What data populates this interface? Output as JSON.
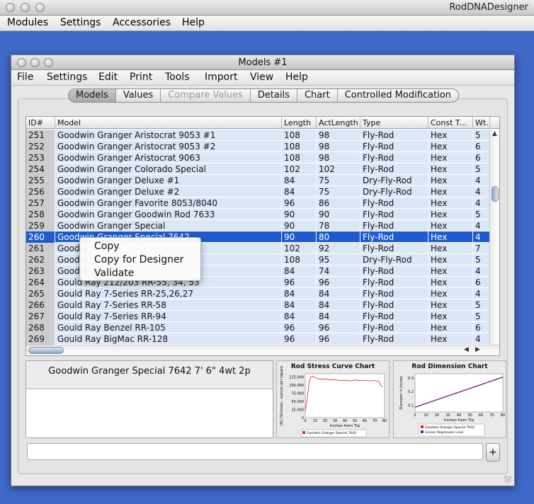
{
  "app": {
    "title": "RodDNADesigner",
    "menus": [
      "Modules",
      "Settings",
      "Accessories",
      "Help"
    ]
  },
  "window": {
    "title": "Models #1",
    "menus": [
      "File",
      "Settings",
      "Edit",
      "Print",
      "Tools",
      "Import",
      "View",
      "Help"
    ]
  },
  "tabs": [
    {
      "label": "Models",
      "state": "active"
    },
    {
      "label": "Values",
      "state": "normal"
    },
    {
      "label": "Compare Values",
      "state": "disabled"
    },
    {
      "label": "Details",
      "state": "normal"
    },
    {
      "label": "Chart",
      "state": "normal"
    },
    {
      "label": "Controlled Modification",
      "state": "normal"
    }
  ],
  "table": {
    "columns": [
      "ID#",
      "Model",
      "Length",
      "ActLength",
      "Type",
      "Const T...",
      "Wt."
    ],
    "rows": [
      [
        "251",
        "Goodwin Granger Aristocrat 9053 #1",
        "108",
        "98",
        "Fly-Rod",
        "Hex",
        "5"
      ],
      [
        "252",
        "Goodwin Granger Aristocrat 9053 #2",
        "108",
        "98",
        "Fly-Rod",
        "Hex",
        "6"
      ],
      [
        "253",
        "Goodwin Granger Aristocrat 9063",
        "108",
        "98",
        "Fly-Rod",
        "Hex",
        "6"
      ],
      [
        "254",
        "Goodwin Granger Colorado Special",
        "102",
        "102",
        "Fly-Rod",
        "Hex",
        "5"
      ],
      [
        "255",
        "Goodwin Granger Deluxe #1",
        "84",
        "75",
        "Dry-Fly-Rod",
        "Hex",
        "4"
      ],
      [
        "256",
        "Goodwin Granger Deluxe #2",
        "84",
        "75",
        "Dry-Fly-Rod",
        "Hex",
        "4"
      ],
      [
        "257",
        "Goodwin Granger Favorite 8053/8040",
        "96",
        "86",
        "Fly-Rod",
        "Hex",
        "4"
      ],
      [
        "258",
        "Goodwin Granger Goodwin Rod 7633",
        "90",
        "90",
        "Fly-Rod",
        "Hex",
        "5"
      ],
      [
        "259",
        "Goodwin Granger Special",
        "90",
        "78",
        "Fly-Rod",
        "Hex",
        "4"
      ],
      [
        "260",
        "Goodwin Granger Special 7642",
        "90",
        "80",
        "Fly-Rod",
        "Hex",
        "4"
      ],
      [
        "261",
        "Goodw",
        "102",
        "92",
        "Fly-Rod",
        "Hex",
        "7"
      ],
      [
        "262",
        "Goodw",
        "108",
        "95",
        "Dry-Fly-Rod",
        "Hex",
        "5"
      ],
      [
        "263",
        "Goodw",
        "84",
        "74",
        "Fly-Rod",
        "Hex",
        "4"
      ],
      [
        "264",
        "Gould Ray 212/203 RR-55, 34, 53",
        "96",
        "96",
        "Fly-Rod",
        "Hex",
        "6"
      ],
      [
        "265",
        "Gould Ray 7-Series RR-25,26,27",
        "84",
        "84",
        "Fly-Rod",
        "Hex",
        "4"
      ],
      [
        "266",
        "Gould Ray 7-Series RR-58",
        "84",
        "84",
        "Fly-Rod",
        "Hex",
        "5"
      ],
      [
        "267",
        "Gould Ray 7-Series RR-94",
        "84",
        "84",
        "Fly-Rod",
        "Hex",
        "5"
      ],
      [
        "268",
        "Gould Ray Benzel RR-105",
        "96",
        "96",
        "Fly-Rod",
        "Hex",
        "6"
      ],
      [
        "269",
        "Gould Ray BigMac RR-128",
        "96",
        "96",
        "Fly-Rod",
        "Hex",
        "4"
      ]
    ],
    "selected_id": "260"
  },
  "context_menu": {
    "items": [
      "Copy",
      "Copy for Designer",
      "Validate"
    ]
  },
  "description": {
    "summary": "Goodwin Granger Special 7642 7' 6\"  4wt 2p"
  },
  "chart_data": [
    {
      "type": "line",
      "title": "Rod Stress Curve Chart",
      "xlabel": "Inches from Tip",
      "ylabel": "(lb) (Stresses - ounces per square",
      "x_ticks": [
        0,
        10,
        20,
        30,
        40,
        50,
        60,
        70,
        80
      ],
      "y_ticks": [
        "0",
        "25,000",
        "50,000",
        "75,000",
        "100,000",
        "125,000"
      ],
      "xlim": [
        0,
        80
      ],
      "ylim": [
        0,
        135000
      ],
      "series": [
        {
          "name": "Goodwin Granger Special 7642",
          "color": "#e02020",
          "x": [
            0,
            2,
            4,
            6,
            8,
            12,
            16,
            20,
            25,
            30,
            35,
            40,
            45,
            50,
            55,
            60,
            65,
            70,
            74,
            76,
            78
          ],
          "values": [
            20000,
            60000,
            110000,
            126000,
            127000,
            120000,
            118000,
            119000,
            116000,
            117000,
            114000,
            115000,
            113000,
            116000,
            114000,
            115000,
            113000,
            114000,
            112000,
            100000,
            95000
          ]
        }
      ]
    },
    {
      "type": "line",
      "title": "Rod Dimension Chart",
      "xlabel": "Inches from Tip",
      "ylabel": "Diameter in Inches",
      "x_ticks": [
        0,
        10,
        20,
        30,
        40,
        50,
        60,
        70,
        80
      ],
      "y_ticks": [
        "0.1",
        "0.2",
        "0.3"
      ],
      "xlim": [
        0,
        80
      ],
      "ylim": [
        0.05,
        0.33
      ],
      "series": [
        {
          "name": "Goodwin Granger Special 7642",
          "color": "#e02020",
          "x": [
            0,
            80
          ],
          "values": [
            0.085,
            0.305
          ]
        },
        {
          "name": "(Linear Regression Line)",
          "color": "#3030c0",
          "x": [
            0,
            80
          ],
          "values": [
            0.085,
            0.305
          ]
        }
      ]
    }
  ]
}
